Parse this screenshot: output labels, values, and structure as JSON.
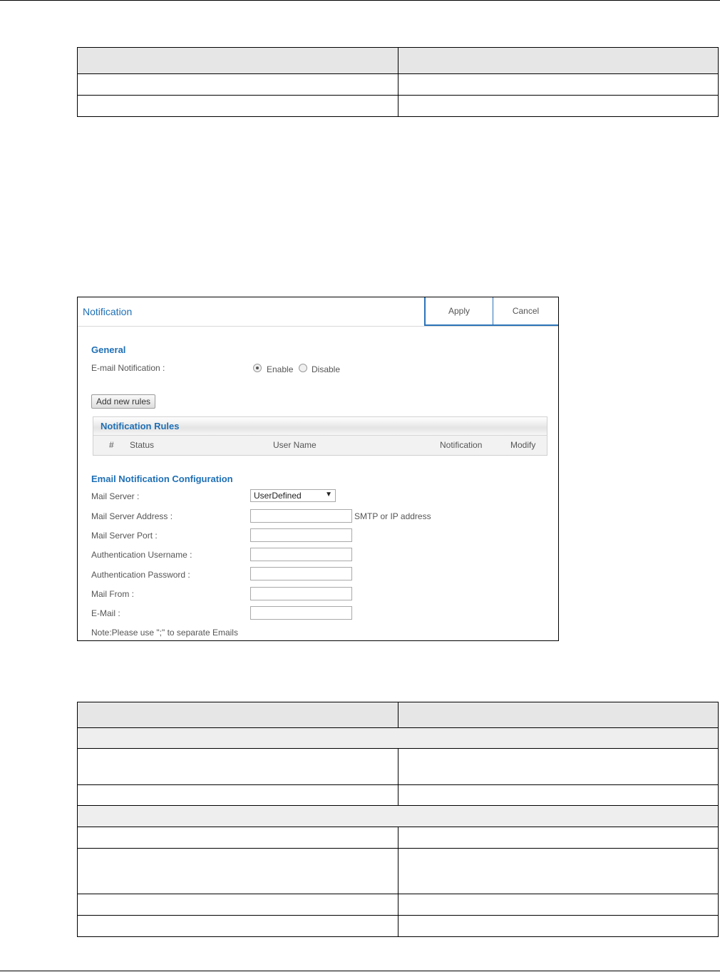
{
  "app": {
    "title": "Notification",
    "apply_label": "Apply",
    "cancel_label": "Cancel"
  },
  "general": {
    "title": "General",
    "email_notification_label": "E-mail Notification :",
    "options": [
      "Enable",
      "Disable"
    ],
    "selected": "Enable"
  },
  "add_rules_label": "Add new rules",
  "rules": {
    "title": "Notification Rules",
    "columns": [
      "#",
      "Status",
      "User Name",
      "Notification",
      "Modify"
    ]
  },
  "email_config": {
    "title": "Email Notification Configuration",
    "mail_server_label": "Mail Server :",
    "mail_server_value": "UserDefined",
    "mail_server_address_label": "Mail Server Address :",
    "mail_server_address_hint": "SMTP or IP address",
    "mail_server_port_label": "Mail Server Port :",
    "auth_username_label": "Authentication Username :",
    "auth_password_label": "Authentication Password :",
    "mail_from_label": "Mail From :",
    "email_label": "E-Mail :",
    "note": "Note:Please use \";\" to separate Emails"
  }
}
